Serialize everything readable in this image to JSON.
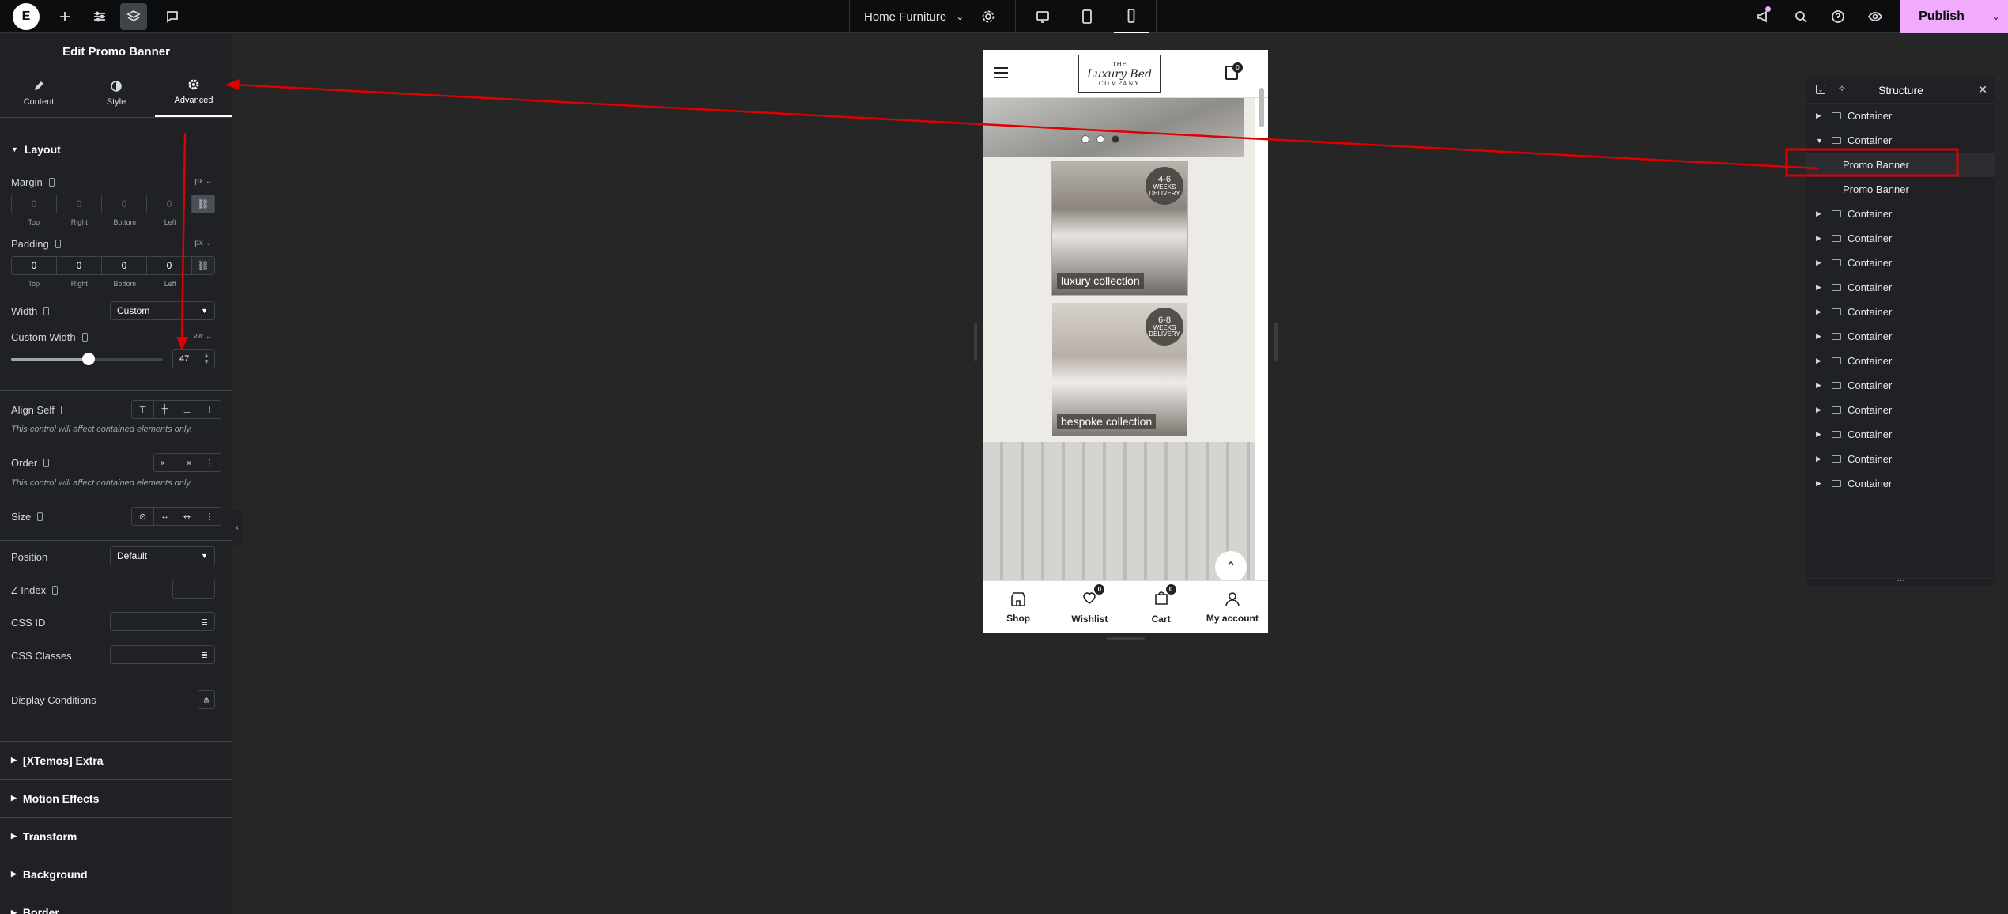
{
  "topbar": {
    "logo": "E",
    "document_title": "Home Furniture",
    "publish_label": "Publish",
    "notification_count": "1"
  },
  "panel": {
    "title": "Edit Promo Banner",
    "tabs": [
      {
        "label": "Content",
        "icon": "pencil-icon"
      },
      {
        "label": "Style",
        "icon": "contrast-icon"
      },
      {
        "label": "Advanced",
        "icon": "gear-icon",
        "active": true
      }
    ],
    "layout": {
      "section_label": "Layout",
      "margin": {
        "label": "Margin",
        "unit": "px",
        "top": "0",
        "right": "0",
        "bottom": "0",
        "left": "0",
        "placeholder": true
      },
      "padding": {
        "label": "Padding",
        "unit": "px",
        "top": "0",
        "right": "0",
        "bottom": "0",
        "left": "0"
      },
      "dim_labels": [
        "Top",
        "Right",
        "Bottom",
        "Left"
      ],
      "width": {
        "label": "Width",
        "value": "Custom"
      },
      "custom_width": {
        "label": "Custom Width",
        "unit": "vw",
        "value": "47",
        "slider_fraction": 0.47
      },
      "align_self": {
        "label": "Align Self"
      },
      "align_note": "This control will affect contained elements only.",
      "order": {
        "label": "Order"
      },
      "order_note": "This control will affect contained elements only.",
      "size": {
        "label": "Size"
      },
      "position": {
        "label": "Position",
        "value": "Default"
      },
      "z_index": {
        "label": "Z-Index"
      },
      "css_id": {
        "label": "CSS ID"
      },
      "css_classes": {
        "label": "CSS Classes"
      },
      "display_conditions": {
        "label": "Display Conditions"
      }
    },
    "sections": [
      "[XTemos] Extra",
      "Motion Effects",
      "Transform",
      "Background",
      "Border"
    ]
  },
  "preview": {
    "logo_line1": "THE",
    "logo_line2": "Luxury Bed",
    "logo_line3": "COMPANY",
    "cart_count": "0",
    "cards": [
      {
        "label": "luxury collection",
        "badge_top": "4-6",
        "badge_mid": "WEEKS",
        "badge_bottom": "DELIVERY"
      },
      {
        "label": "bespoke collection",
        "badge_top": "6-8",
        "badge_mid": "WEEKS",
        "badge_bottom": "DELIVERY"
      }
    ],
    "bottom_nav": [
      {
        "label": "Shop",
        "icon": "shop-icon"
      },
      {
        "label": "Wishlist",
        "icon": "heart-icon",
        "count": "0"
      },
      {
        "label": "Cart",
        "icon": "cart-icon",
        "count": "0"
      },
      {
        "label": "My account",
        "icon": "user-icon"
      }
    ]
  },
  "structure": {
    "title": "Structure",
    "rows": [
      {
        "label": "Container",
        "depth": 0,
        "expanded": false
      },
      {
        "label": "Container",
        "depth": 0,
        "expanded": true
      },
      {
        "label": "Promo Banner",
        "depth": 1,
        "selected": true
      },
      {
        "label": "Promo Banner",
        "depth": 1
      },
      {
        "label": "Container",
        "depth": 0
      },
      {
        "label": "Container",
        "depth": 0
      },
      {
        "label": "Container",
        "depth": 0
      },
      {
        "label": "Container",
        "depth": 0
      },
      {
        "label": "Container",
        "depth": 0
      },
      {
        "label": "Container",
        "depth": 0
      },
      {
        "label": "Container",
        "depth": 0
      },
      {
        "label": "Container",
        "depth": 0
      },
      {
        "label": "Container",
        "depth": 0
      },
      {
        "label": "Container",
        "depth": 0
      },
      {
        "label": "Container",
        "depth": 0
      },
      {
        "label": "Container",
        "depth": 0
      }
    ]
  },
  "colors": {
    "accent": "#f0abfc",
    "annotation": "#e00000",
    "panel_bg": "#1f2124",
    "canvas_bg": "#262626"
  }
}
